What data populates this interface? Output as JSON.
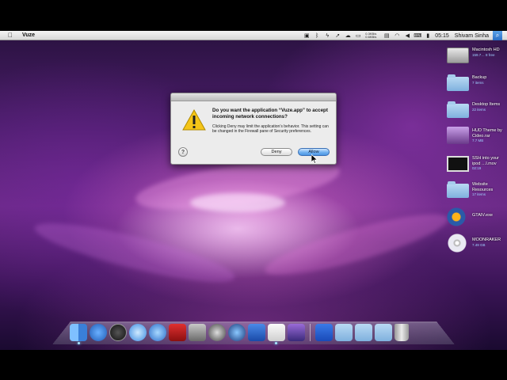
{
  "menubar": {
    "apple_glyph": "",
    "app_name": "Vuze",
    "net_up": "0.3KB/s",
    "net_down": "0.6KB/s",
    "clock": "05:15",
    "user": "Shivam Sinha",
    "status_icons": [
      "video-icon",
      "bluetooth-icon",
      "bolt-icon",
      "arrow-icon",
      "cloud-icon",
      "battery-icon",
      "wifi-icon",
      "volume-icon",
      "keyboard-icon",
      "display-icon"
    ]
  },
  "desktop_icons": [
    {
      "label": "Macintosh HD",
      "sub": "159.7… 8 free",
      "icon": "hard-drive-icon"
    },
    {
      "label": "Backup",
      "sub": "7 items",
      "icon": "folder-icon"
    },
    {
      "label": "Desktop Items",
      "sub": "22 items",
      "icon": "folder-icon"
    },
    {
      "label": "HUD Theme by Cideo.rar",
      "sub": "7.7 MB",
      "icon": "archive-icon"
    },
    {
      "label": "SSH into your ipod …l.mov",
      "sub": "02:19",
      "icon": "movie-icon"
    },
    {
      "label": "Website Resources",
      "sub": "17 items",
      "icon": "folder-icon"
    },
    {
      "label": "GTAIV.exe",
      "sub": "",
      "icon": "gta-icon"
    },
    {
      "label": "MOONRAKER",
      "sub": "7.49 GB",
      "icon": "disc-icon"
    }
  ],
  "dialog": {
    "title": "Do you want the application “Vuze.app” to accept incoming network connections?",
    "body": "Clicking Deny may limit the application’s behavior. This setting can be changed in the Firewall pane of Security preferences.",
    "help_label": "?",
    "deny_label": "Deny",
    "allow_label": "Allow"
  },
  "dock": {
    "items": [
      "finder-icon",
      "app-store-icon",
      "dashboard-icon",
      "safari-icon",
      "itunes-icon",
      "photo-booth-icon",
      "system-preferences-icon",
      "screenshot-icon",
      "quicktime-icon",
      "vuze-icon",
      "text-edit-icon",
      "imovie-icon"
    ],
    "stack_items": [
      "iweb-icon",
      "applications-folder-icon",
      "documents-folder-icon",
      "downloads-folder-icon",
      "trash-icon"
    ]
  },
  "colors": {
    "allow_button": "#6fb0f0",
    "menubar": "#e6e6e6",
    "wallpaper_accent": "#e06ad0"
  }
}
